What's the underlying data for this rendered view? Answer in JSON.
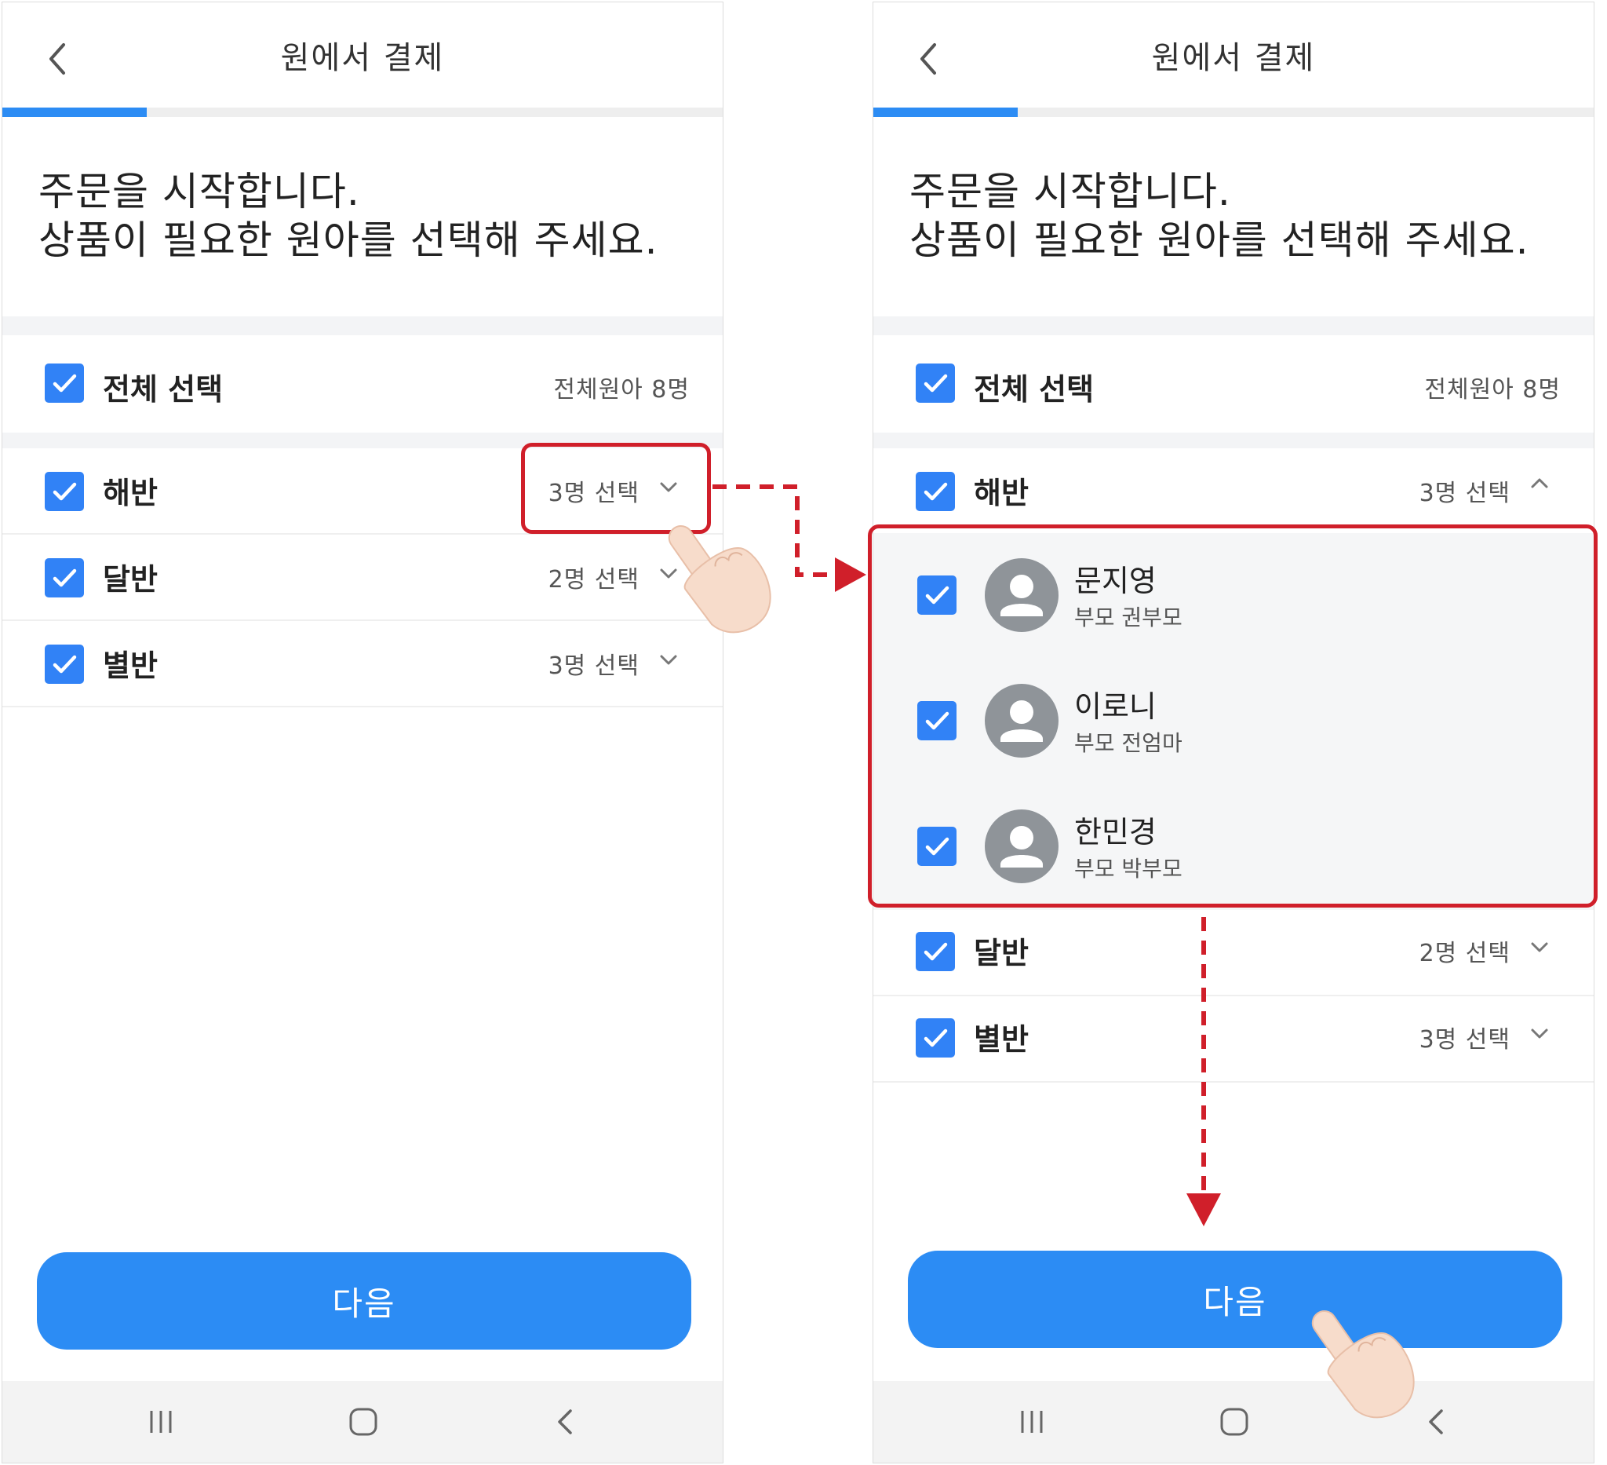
{
  "colors": {
    "accent": "#2c8cf4",
    "checkbox": "#3182f6",
    "highlight": "#d01f2a",
    "avatar": "#8f9499"
  },
  "screens": [
    {
      "header": {
        "title": "원에서 결제",
        "back_icon": "chevron-left-icon"
      },
      "progress": {
        "fraction": 0.2
      },
      "intro": {
        "line1": "주문을 시작합니다.",
        "line2": "상품이 필요한 원아를 선택해 주세요."
      },
      "select_all": {
        "label": "전체 선택",
        "count_text": "전체원아 8명",
        "checked": true
      },
      "classes": [
        {
          "label": "해반",
          "selected_text": "3명 선택",
          "checked": true,
          "expanded": false
        },
        {
          "label": "달반",
          "selected_text": "2명 선택",
          "checked": true,
          "expanded": false
        },
        {
          "label": "별반",
          "selected_text": "3명 선택",
          "checked": true,
          "expanded": false
        }
      ],
      "next_button": {
        "label": "다음"
      },
      "navbar": {
        "icons": [
          "recent-apps-icon",
          "home-icon",
          "back-icon"
        ]
      }
    },
    {
      "header": {
        "title": "원에서 결제",
        "back_icon": "chevron-left-icon"
      },
      "progress": {
        "fraction": 0.2
      },
      "intro": {
        "line1": "주문을 시작합니다.",
        "line2": "상품이 필요한 원아를 선택해 주세요."
      },
      "select_all": {
        "label": "전체 선택",
        "count_text": "전체원아 8명",
        "checked": true
      },
      "classes": [
        {
          "label": "해반",
          "selected_text": "3명 선택",
          "checked": true,
          "expanded": true
        },
        {
          "label": "달반",
          "selected_text": "2명 선택",
          "checked": true,
          "expanded": false
        },
        {
          "label": "별반",
          "selected_text": "3명 선택",
          "checked": true,
          "expanded": false
        }
      ],
      "members": [
        {
          "name": "문지영",
          "guardian": "부모 권부모",
          "checked": true
        },
        {
          "name": "이로니",
          "guardian": "부모 전엄마",
          "checked": true
        },
        {
          "name": "한민경",
          "guardian": "부모 박부모",
          "checked": true
        }
      ],
      "next_button": {
        "label": "다음"
      },
      "navbar": {
        "icons": [
          "recent-apps-icon",
          "home-icon",
          "back-icon"
        ]
      }
    }
  ]
}
